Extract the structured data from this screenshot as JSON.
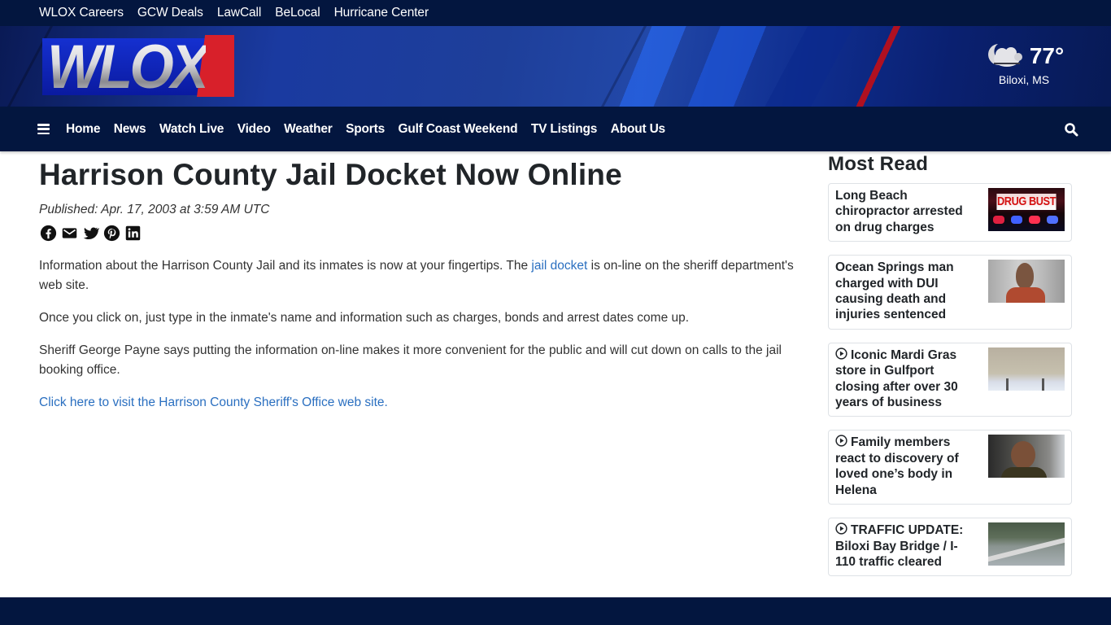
{
  "utility_nav": [
    "WLOX Careers",
    "GCW Deals",
    "LawCall",
    "BeLocal",
    "Hurricane Center"
  ],
  "brand": {
    "logo_text": "WLOX",
    "primary_color": "#03163f",
    "accent_red": "#d8202a",
    "link_color": "#2a6fc0"
  },
  "weather": {
    "icon": "partly-cloudy-night-icon",
    "temperature": "77°",
    "location": "Biloxi, MS"
  },
  "main_nav": {
    "menu_icon": "hamburger-icon",
    "items": [
      "Home",
      "News",
      "Watch Live",
      "Video",
      "Weather",
      "Sports",
      "Gulf Coast Weekend",
      "TV Listings",
      "About Us"
    ],
    "search_icon": "search-icon"
  },
  "article": {
    "headline": "Harrison County Jail Docket Now Online",
    "published": "Published: Apr. 17, 2003 at 3:59 AM UTC",
    "share_icons": [
      "facebook-icon",
      "email-icon",
      "twitter-icon",
      "pinterest-icon",
      "linkedin-icon"
    ],
    "paragraphs": {
      "p1_before": "Information about the Harrison County Jail and its inmates is now at your fingertips. The ",
      "p1_link": "jail docket",
      "p1_after": " is on-line on the sheriff department's web site.",
      "p2": "Once you click on, just type in the inmate's name and information such as charges, bonds and arrest dates come up.",
      "p3": "Sheriff George Payne says putting the information on-line makes it more convenient for the public and will cut down on calls to the jail booking office.",
      "p4_link": "Click here to visit the Harrison County Sheriff's Office web site."
    }
  },
  "most_read": {
    "heading": "Most Read",
    "items": [
      {
        "title": "Long Beach chiropractor arrested on drug charges",
        "video": false,
        "thumb_text": "DRUG BUST"
      },
      {
        "title": "Ocean Springs man charged with DUI causing death and injuries sentenced",
        "video": false
      },
      {
        "title": "Iconic Mardi Gras store in Gulfport closing after over 30 years of business",
        "video": true
      },
      {
        "title": "Family members react to discovery of loved one’s body in Helena",
        "video": true
      },
      {
        "title": "TRAFFIC UPDATE: Biloxi Bay Bridge / I-110 traffic cleared",
        "video": true
      }
    ]
  }
}
